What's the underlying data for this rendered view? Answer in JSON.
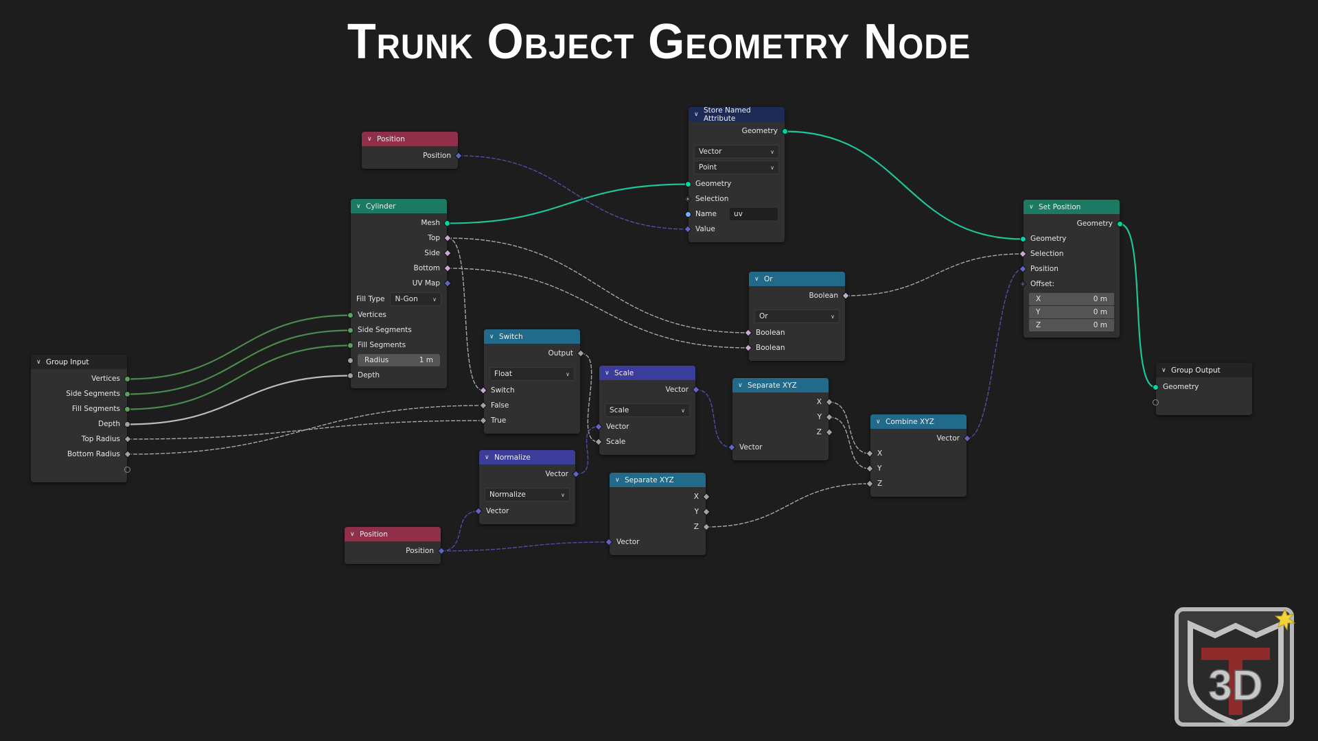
{
  "title": "Trunk Object Geometry Node",
  "colors": {
    "background": "#1d1d1d",
    "node_body": "#303030",
    "header_input": "#8f2f4a",
    "header_geometry": "#1d7a62",
    "header_attribute": "#1e2a56",
    "header_converter": "#216a8a",
    "header_vector": "#3c3d9a",
    "header_group": "#232323",
    "socket_geometry": "#00d6a3",
    "socket_int": "#5da05c",
    "socket_float": "#a1a1a1",
    "socket_field": "#cca6d6",
    "socket_vector": "#6363c7",
    "socket_string": "#70b2ff",
    "link_geometry": "#1fc49a",
    "link_int": "#4b8a4c",
    "link_float": "#bdbdbd",
    "link_vector": "#5a4aa8",
    "link_field": "#a8a8a8"
  },
  "nodes": {
    "position_top": {
      "title": "Position",
      "outputs": [
        "Position"
      ]
    },
    "cylinder": {
      "title": "Cylinder",
      "outputs": [
        "Mesh",
        "Top",
        "Side",
        "Bottom",
        "UV Map"
      ],
      "fill_type_label": "Fill Type",
      "fill_type_value": "N-Gon",
      "inputs": [
        "Vertices",
        "Side Segments",
        "Fill Segments"
      ],
      "radius_label": "Radius",
      "radius_value": "1 m",
      "depth_label": "Depth"
    },
    "store_named_attribute": {
      "title": "Store Named Attribute",
      "output": "Geometry",
      "data_type": "Vector",
      "domain": "Point",
      "inputs": [
        "Geometry",
        "Selection"
      ],
      "name_label": "Name",
      "name_value": "uv",
      "value_label": "Value"
    },
    "set_position": {
      "title": "Set Position",
      "output": "Geometry",
      "inputs": [
        "Geometry",
        "Selection",
        "Position",
        "Offset:"
      ],
      "offset": [
        {
          "axis": "X",
          "value": "0 m"
        },
        {
          "axis": "Y",
          "value": "0 m"
        },
        {
          "axis": "Z",
          "value": "0 m"
        }
      ]
    },
    "or": {
      "title": "Or",
      "output": "Boolean",
      "operation": "Or",
      "inputs": [
        "Boolean",
        "Boolean"
      ]
    },
    "group_input": {
      "title": "Group Input",
      "outputs": [
        "Vertices",
        "Side Segments",
        "Fill Segments",
        "Depth",
        "Top Radius",
        "Bottom Radius"
      ]
    },
    "switch": {
      "title": "Switch",
      "output": "Output",
      "data_type": "Float",
      "inputs": [
        "Switch",
        "False",
        "True"
      ]
    },
    "scale": {
      "title": "Scale",
      "output": "Vector",
      "operation": "Scale",
      "inputs": [
        "Vector",
        "Scale"
      ]
    },
    "separate_xyz_1": {
      "title": "Separate XYZ",
      "outputs": [
        "X",
        "Y",
        "Z"
      ],
      "input": "Vector"
    },
    "combine_xyz": {
      "title": "Combine XYZ",
      "output": "Vector",
      "inputs": [
        "X",
        "Y",
        "Z"
      ]
    },
    "normalize": {
      "title": "Normalize",
      "output": "Vector",
      "operation": "Normalize",
      "input": "Vector"
    },
    "position_bottom": {
      "title": "Position",
      "outputs": [
        "Position"
      ]
    },
    "separate_xyz_2": {
      "title": "Separate XYZ",
      "outputs": [
        "X",
        "Y",
        "Z"
      ],
      "input": "Vector"
    },
    "group_output": {
      "title": "Group Output",
      "inputs": [
        "Geometry"
      ]
    }
  },
  "links": [
    {
      "from": "cyl-out-mesh",
      "to": "sna-in-geometry",
      "type": "geometry"
    },
    {
      "from": "sna-out-geometry",
      "to": "sp-in-geometry",
      "type": "geometry"
    },
    {
      "from": "sp-out-geometry",
      "to": "go-in-geometry",
      "type": "geometry"
    },
    {
      "from": "pos1-out-position",
      "to": "sna-in-value",
      "type": "vector"
    },
    {
      "from": "cyl-out-top",
      "to": "or-in-boolean1",
      "type": "field"
    },
    {
      "from": "cyl-out-bottom",
      "to": "or-in-boolean2",
      "type": "field"
    },
    {
      "from": "cyl-out-top",
      "to": "sw-in-switch",
      "type": "field"
    },
    {
      "from": "or-out-boolean",
      "to": "sp-in-selection",
      "type": "field"
    },
    {
      "from": "gi-out-vertices",
      "to": "cyl-in-vertices",
      "type": "int"
    },
    {
      "from": "gi-out-sidesegments",
      "to": "cyl-in-sidesegments",
      "type": "int"
    },
    {
      "from": "gi-out-fillsegments",
      "to": "cyl-in-fillsegments",
      "type": "int"
    },
    {
      "from": "gi-out-depth",
      "to": "cyl-in-depth",
      "type": "float"
    },
    {
      "from": "gi-out-topradius",
      "to": "sw-in-true",
      "type": "field"
    },
    {
      "from": "gi-out-bottomradius",
      "to": "sw-in-false",
      "type": "field"
    },
    {
      "from": "sw-out-output",
      "to": "sc-in-scale",
      "type": "field"
    },
    {
      "from": "nm-out-vector",
      "to": "sc-in-vector",
      "type": "vector"
    },
    {
      "from": "sc-out-vector",
      "to": "sx1-in-vector",
      "type": "vector"
    },
    {
      "from": "sx1-out-x",
      "to": "cx-in-x",
      "type": "field"
    },
    {
      "from": "sx1-out-y",
      "to": "cx-in-y",
      "type": "field"
    },
    {
      "from": "sx2-out-z",
      "to": "cx-in-z",
      "type": "field"
    },
    {
      "from": "cx-out-vector",
      "to": "sp-in-position",
      "type": "vector"
    },
    {
      "from": "pos2-out-position",
      "to": "nm-in-vector",
      "type": "vector"
    },
    {
      "from": "pos2-out-position",
      "to": "sx2-in-vector",
      "type": "vector"
    }
  ]
}
